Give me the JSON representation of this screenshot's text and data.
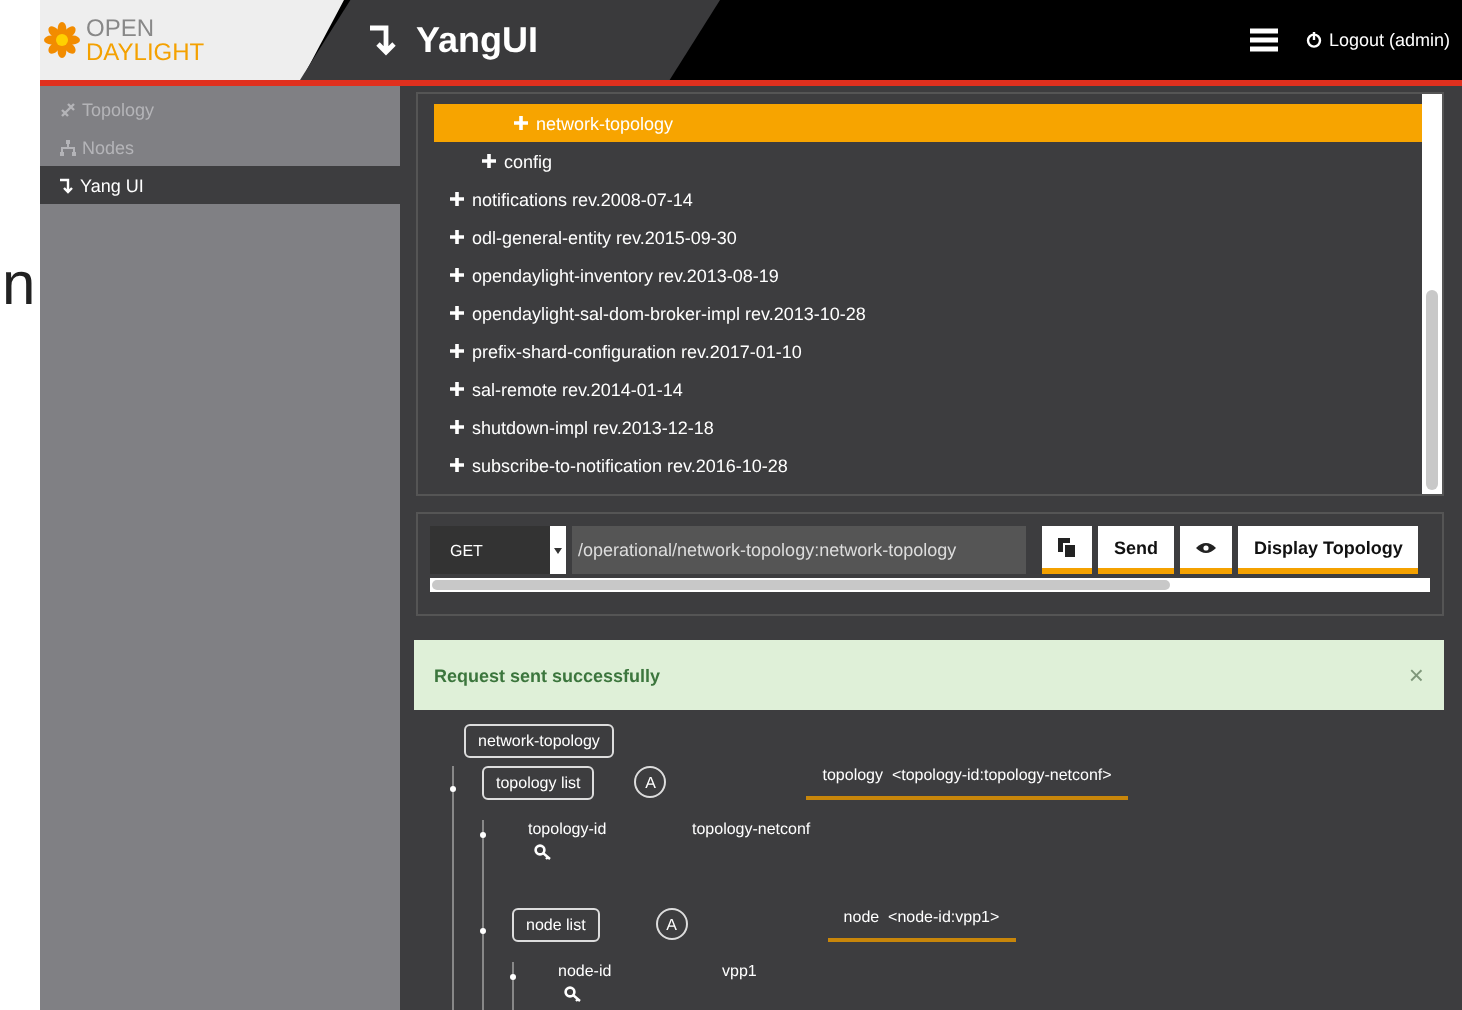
{
  "page_edge_text": "n",
  "header": {
    "logo_top": "OPEN",
    "logo_bottom": "DAYLIGHT",
    "title": "YangUI",
    "logout": "Logout (admin)"
  },
  "sidebar": {
    "items": [
      {
        "label": "Topology",
        "kind": "topology",
        "selected": false
      },
      {
        "label": "Nodes",
        "kind": "nodes",
        "selected": false
      },
      {
        "label": "Yang UI",
        "kind": "yangui",
        "selected": true
      }
    ]
  },
  "module_tree": {
    "items": [
      {
        "children": [
          {
            "children": [
              {
                "label": "network-topology",
                "selected": true
              }
            ]
          },
          {
            "label": "config",
            "selected": false
          }
        ]
      },
      {
        "label": "notifications rev.2008-07-14",
        "selected": false
      },
      {
        "label": "odl-general-entity rev.2015-09-30",
        "selected": false
      },
      {
        "label": "opendaylight-inventory rev.2013-08-19",
        "selected": false
      },
      {
        "label": "opendaylight-sal-dom-broker-impl rev.2013-10-28",
        "selected": false
      },
      {
        "label": "prefix-shard-configuration rev.2017-01-10",
        "selected": false
      },
      {
        "label": "sal-remote rev.2014-01-14",
        "selected": false
      },
      {
        "label": "shutdown-impl rev.2013-12-18",
        "selected": false
      },
      {
        "label": "subscribe-to-notification rev.2016-10-28",
        "selected": false
      }
    ]
  },
  "request": {
    "method": "GET",
    "path": "/operational/network-topology:network-topology",
    "buttons": [
      {
        "kind": "copy"
      },
      {
        "kind": "text",
        "label": "Send"
      },
      {
        "kind": "preview"
      },
      {
        "kind": "text",
        "label": "Display Topology"
      }
    ]
  },
  "alert": {
    "message": "Request sent successfully",
    "close": "×"
  },
  "data_tree": {
    "label": "network-topology",
    "children": [
      {
        "kind": "list",
        "label": "topology list",
        "badge": "A",
        "entry": "topology  <topology-id:topology-netconf>",
        "children": [
          {
            "kind": "leaf",
            "label": "topology-id",
            "value": "topology-netconf",
            "key": true
          },
          {
            "kind": "list",
            "label": "node list",
            "badge": "A",
            "entry": "node  <node-id:vpp1>",
            "children": [
              {
                "kind": "leaf",
                "label": "node-id",
                "value": "vpp1",
                "key": true
              }
            ]
          }
        ]
      }
    ]
  }
}
